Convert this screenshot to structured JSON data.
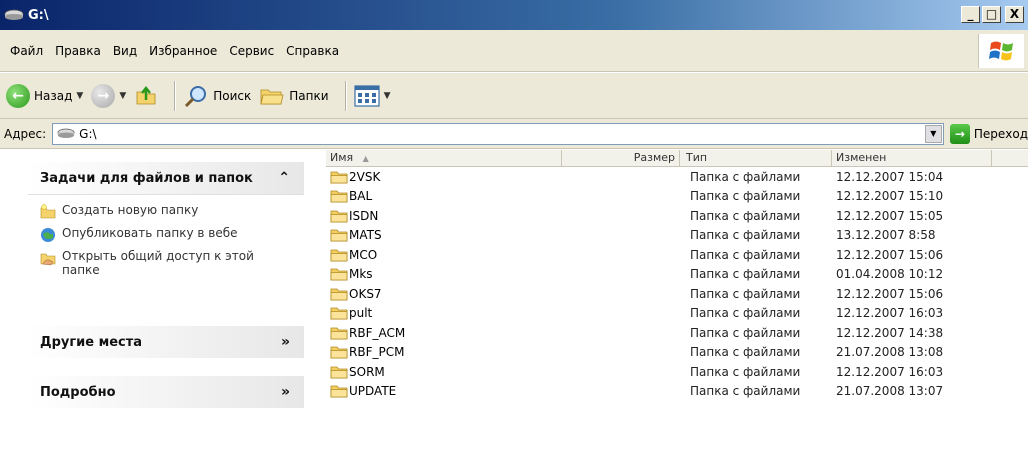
{
  "window": {
    "title": "G:\\",
    "controls": {
      "minimize": "_",
      "maximize": "□",
      "close": "X"
    }
  },
  "menu": {
    "items": [
      {
        "label": "Файл"
      },
      {
        "label": "Правка"
      },
      {
        "label": "Вид"
      },
      {
        "label": "Избранное"
      },
      {
        "label": "Сервис"
      },
      {
        "label": "Справка"
      }
    ]
  },
  "toolbar": {
    "back_label": "Назад",
    "search_label": "Поиск",
    "folders_label": "Папки"
  },
  "address": {
    "label": "Адрес:",
    "value": "G:\\",
    "go_label": "Переход"
  },
  "taskpane": {
    "tasks_panel": {
      "title": "Задачи для файлов и папок",
      "items": [
        {
          "label": "Создать новую папку",
          "icon": "new-folder-icon"
        },
        {
          "label": "Опубликовать папку в вебе",
          "icon": "publish-web-icon"
        },
        {
          "label": "Открыть общий доступ к этой папке",
          "icon": "share-folder-icon"
        }
      ]
    },
    "places_panel": {
      "title": "Другие места"
    },
    "details_panel": {
      "title": "Подробно"
    }
  },
  "columns": {
    "name": "Имя",
    "size": "Размер",
    "type": "Тип",
    "modified": "Изменен"
  },
  "files": [
    {
      "name": "2VSK",
      "size": "",
      "type": "Папка с файлами",
      "modified": "12.12.2007 15:04"
    },
    {
      "name": "BAL",
      "size": "",
      "type": "Папка с файлами",
      "modified": "12.12.2007 15:10"
    },
    {
      "name": "ISDN",
      "size": "",
      "type": "Папка с файлами",
      "modified": "12.12.2007 15:05"
    },
    {
      "name": "MATS",
      "size": "",
      "type": "Папка с файлами",
      "modified": "13.12.2007 8:58"
    },
    {
      "name": "MCO",
      "size": "",
      "type": "Папка с файлами",
      "modified": "12.12.2007 15:06"
    },
    {
      "name": "Mks",
      "size": "",
      "type": "Папка с файлами",
      "modified": "01.04.2008 10:12"
    },
    {
      "name": "OKS7",
      "size": "",
      "type": "Папка с файлами",
      "modified": "12.12.2007 15:06"
    },
    {
      "name": "pult",
      "size": "",
      "type": "Папка с файлами",
      "modified": "12.12.2007 16:03"
    },
    {
      "name": "RBF_ACM",
      "size": "",
      "type": "Папка с файлами",
      "modified": "12.12.2007 14:38"
    },
    {
      "name": "RBF_PCM",
      "size": "",
      "type": "Папка с файлами",
      "modified": "21.07.2008 13:08"
    },
    {
      "name": "SORM",
      "size": "",
      "type": "Папка с файлами",
      "modified": "12.12.2007 16:03"
    },
    {
      "name": "UPDATE",
      "size": "",
      "type": "Папка с файлами",
      "modified": "21.07.2008 13:07"
    }
  ]
}
